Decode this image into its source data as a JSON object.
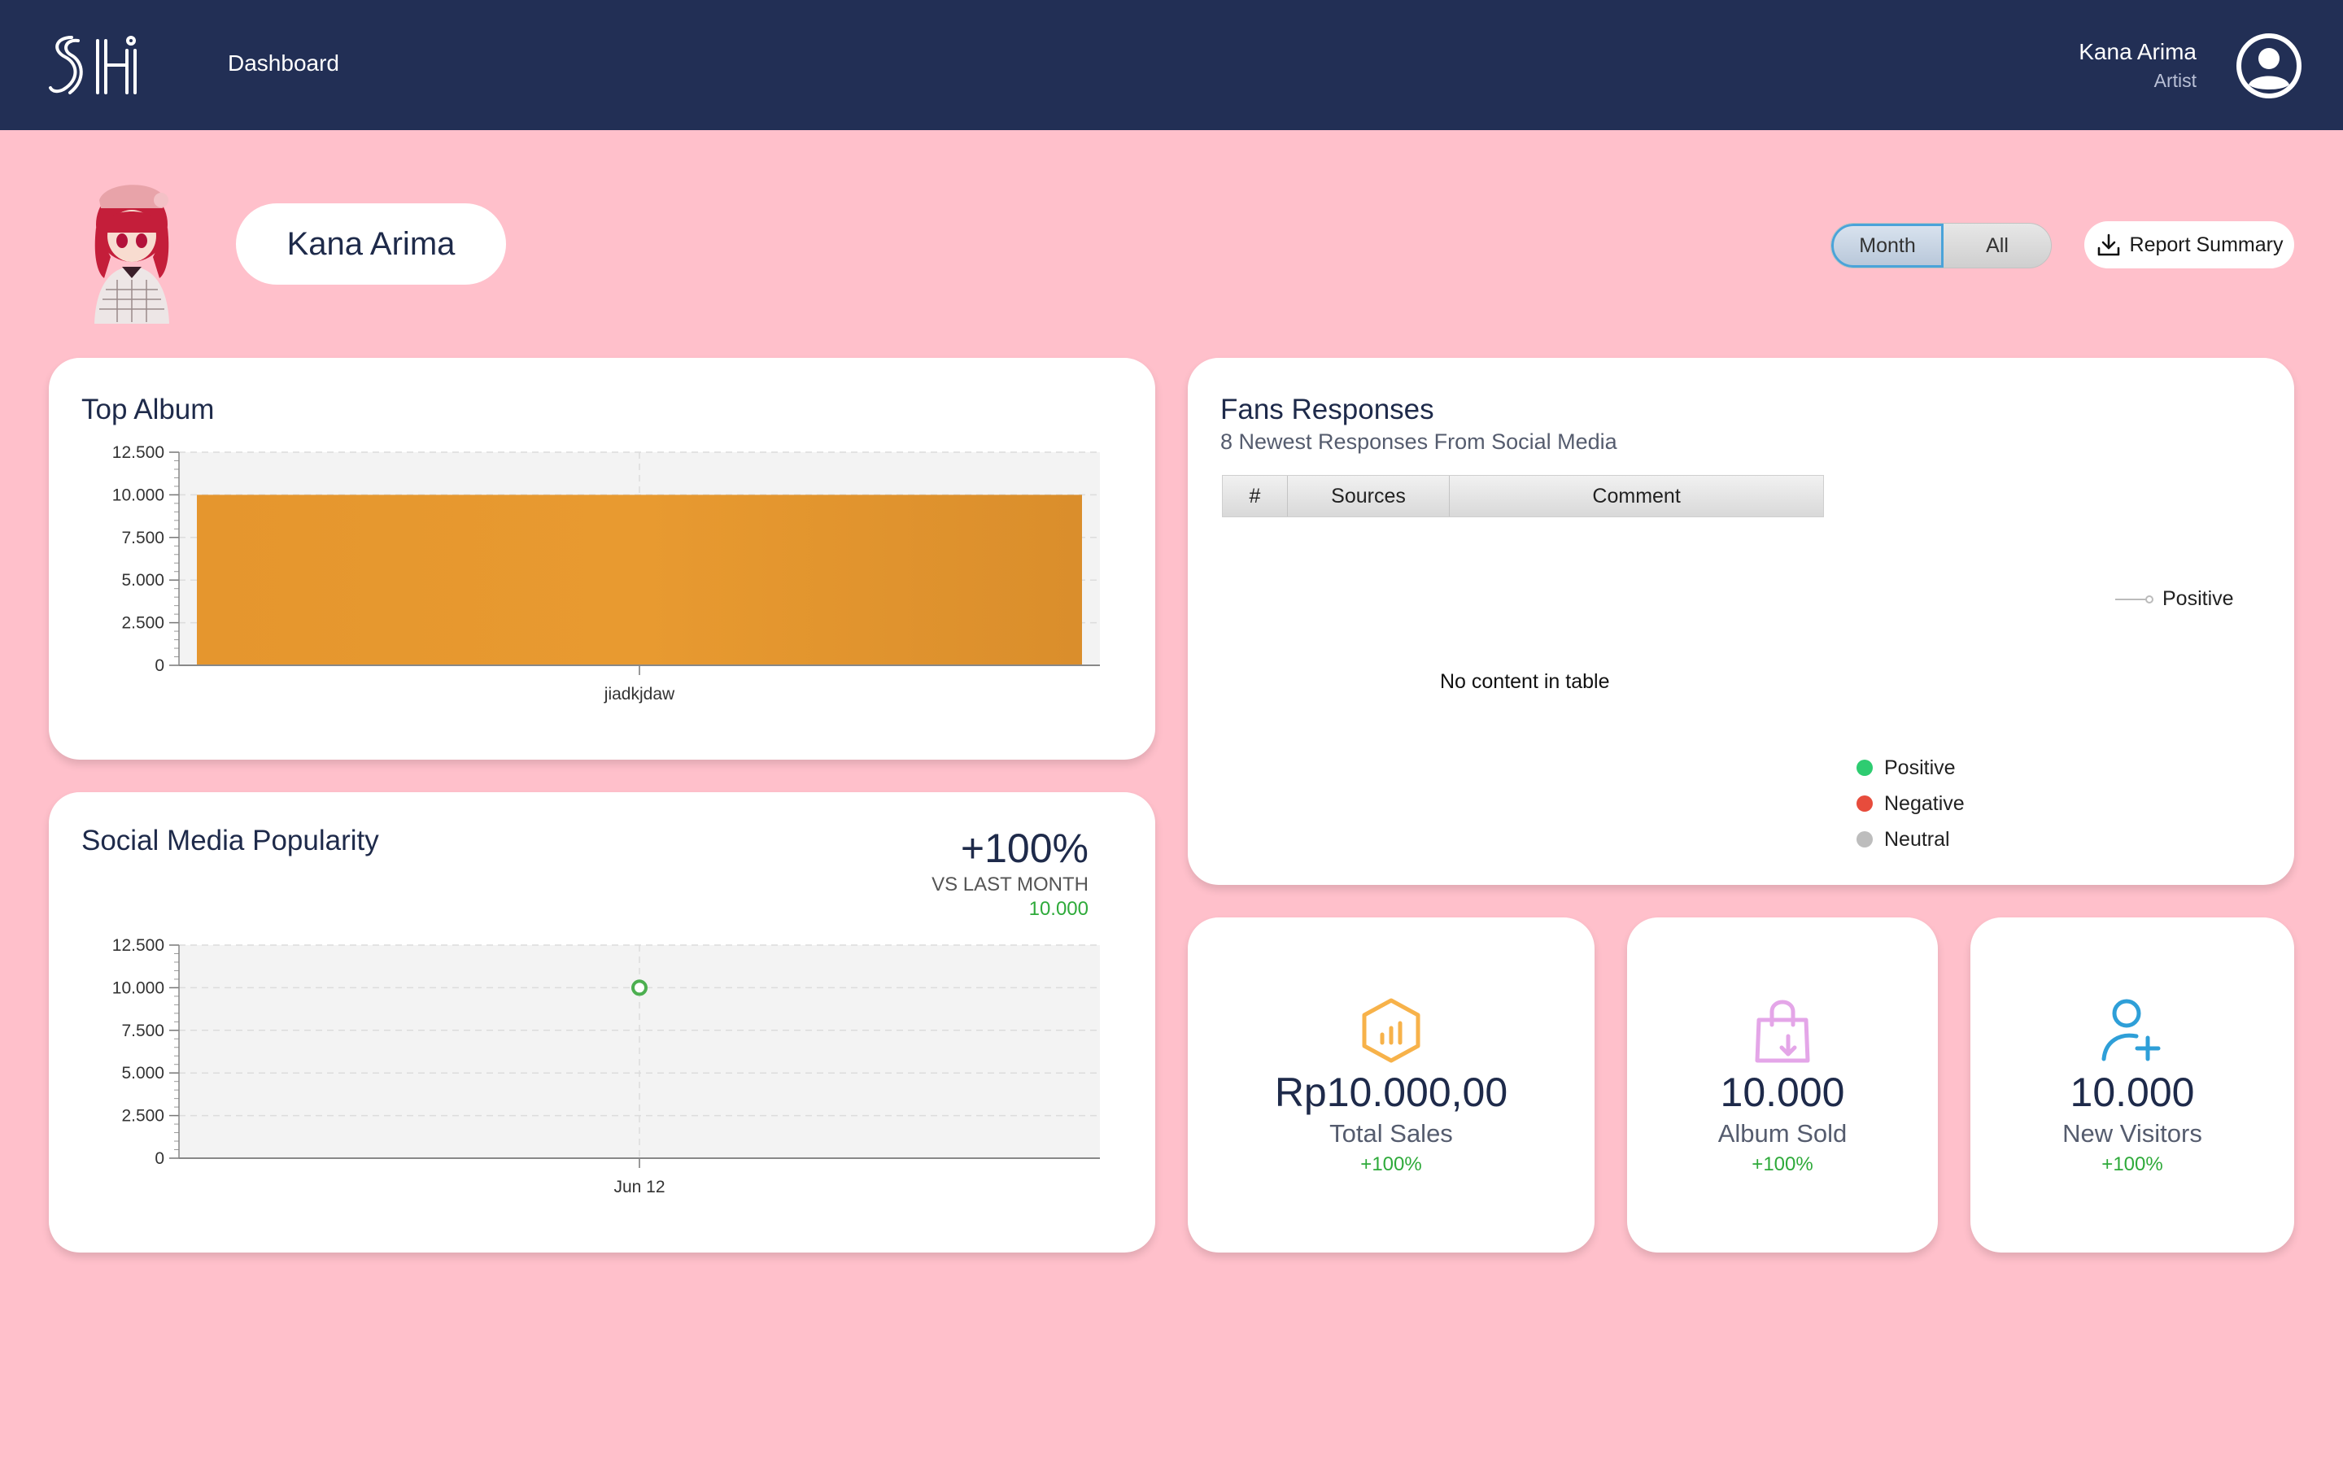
{
  "navbar": {
    "nav_link": "Dashboard",
    "user_name": "Kana Arima",
    "user_role": "Artist"
  },
  "profile": {
    "artist_name": "Kana Arima"
  },
  "filters": {
    "month_label": "Month",
    "all_label": "All",
    "selected": "Month"
  },
  "report_button": {
    "label": "Report Summary",
    "icon": "download-icon"
  },
  "top_album": {
    "title": "Top Album"
  },
  "social_media": {
    "title": "Social Media Popularity",
    "change": "+100%",
    "vs_label": "VS LAST MONTH",
    "vs_value": "10.000"
  },
  "fans": {
    "title": "Fans Responses",
    "subtitle": "8 Newest Responses From Social Media",
    "columns": [
      "#",
      "Sources",
      "Comment"
    ],
    "empty_message": "No content in table",
    "line_legend": "Positive",
    "pie_legend": [
      {
        "label": "Positive",
        "color": "#2ecc71"
      },
      {
        "label": "Negative",
        "color": "#e74c3c"
      },
      {
        "label": "Neutral",
        "color": "#bdbdbd"
      }
    ]
  },
  "stats": [
    {
      "value": "Rp10.000,00",
      "label": "Total Sales",
      "change": "+100%",
      "icon": "chart-hexagon-icon",
      "color": "#f7b24a"
    },
    {
      "value": "10.000",
      "label": "Album Sold",
      "change": "+100%",
      "icon": "shopping-bag-icon",
      "color": "#e4a6e8"
    },
    {
      "value": "10.000",
      "label": "New Visitors",
      "change": "+100%",
      "icon": "add-user-icon",
      "color": "#2e9fd8"
    }
  ],
  "chart_data": [
    {
      "type": "bar",
      "categories": [
        "jiadkjdaw"
      ],
      "values": [
        10000
      ],
      "ylim": [
        0,
        12500
      ],
      "yticks": [
        "0",
        "2.500",
        "5.000",
        "7.500",
        "10.000",
        "12.500"
      ],
      "grid": true,
      "color": "#e89a2d"
    },
    {
      "type": "line",
      "x": [
        "Jun 12"
      ],
      "values": [
        10000
      ],
      "ylim": [
        0,
        12500
      ],
      "yticks": [
        "0",
        "2.500",
        "5.000",
        "7.500",
        "10.000",
        "12.500"
      ],
      "grid": true,
      "color": "#4caf50"
    }
  ]
}
